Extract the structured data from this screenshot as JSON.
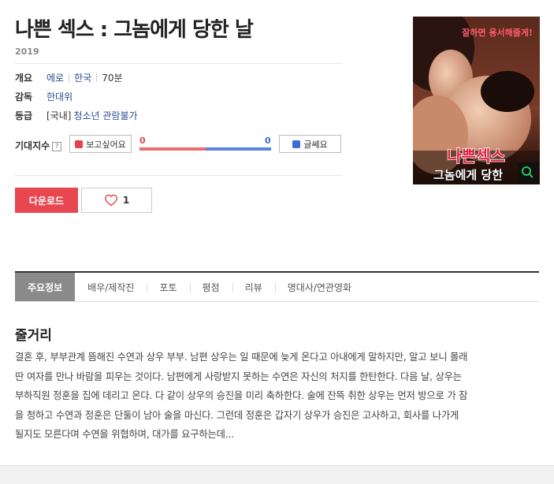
{
  "movie": {
    "title": "나쁜 섹스 : 그놈에게 당한 날",
    "year": "2019",
    "info_rows": {
      "overview_label": "개요",
      "genre": "에로",
      "country": "한국",
      "runtime": "70분",
      "director_label": "감독",
      "director": "한대위",
      "rating_label": "등급",
      "rating_prefix": "[국내]",
      "rating": "청소년 관람불가"
    },
    "expectation": {
      "label": "기대지수",
      "help": "?",
      "want_label": "보고싶어요",
      "meh_label": "글쎄요",
      "want_count": "0",
      "meh_count": "0",
      "want_ratio": 0.5
    },
    "actions": {
      "download_label": "다운로드",
      "like_count": "1"
    },
    "poster": {
      "tagline": "잘하면 용서해줄게!",
      "title_line1": "나쁜섹스",
      "title_line2": "그놈에게 당한"
    }
  },
  "tabs": [
    {
      "label": "주요정보",
      "active": true
    },
    {
      "label": "배우/제작진"
    },
    {
      "label": "포토"
    },
    {
      "label": "평점"
    },
    {
      "label": "리뷰"
    },
    {
      "label": "명대사/연관영화"
    }
  ],
  "synopsis": {
    "title": "줄거리",
    "line1": "결혼 후, 부부관계 뜸해진 수연과 상우 부부. 남편 상우는 일 때문에 늦게 온다고 아내에게 말하지만, 알고 보니 몰래",
    "line2": "딴 여자를 만나 바람을 피우는 것이다. 남편에게 사랑받지 못하는 수연은 자신의 처지를 한탄한다. 다음 날, 상우는",
    "line3": "부하직원 정훈을 집에 데리고 온다. 다 같이 상우의 승진을 미리 축하한다. 술에 잔뜩 취한 상우는 먼저 방으로 가 잠",
    "line4": "을 청하고 수연과 정훈은 단둘이 남아 술을 마신다. 그런데 정훈은 갑자기 상우가 승진은 고사하고, 회사를 나가게",
    "line5": "될지도 모른다며 수연을 위협하며, 대가를 요구하는데..."
  },
  "colors": {
    "accent_red": "#e8474f",
    "accent_blue": "#3c6fd6",
    "link": "#2a4d8f",
    "tab_active_bg": "#8a8a8a"
  }
}
